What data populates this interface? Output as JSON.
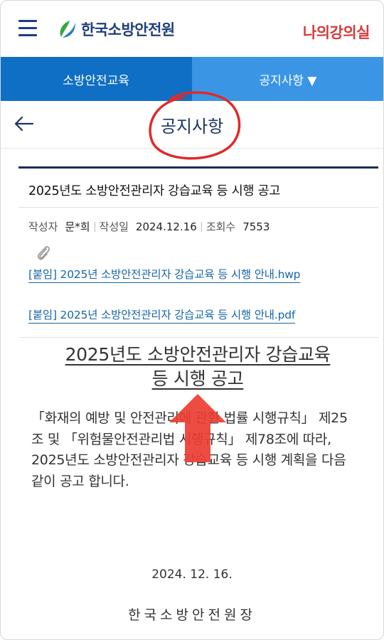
{
  "header": {
    "logo_text": "한국소방안전원",
    "my_course": "나의강의실"
  },
  "nav": {
    "tab1": "소방안전교육",
    "tab2": "공지사항 ▼"
  },
  "page": {
    "title": "공지사항"
  },
  "notice": {
    "title": "2025년도 소방안전관리자 강습교육 등 시행 공고",
    "meta": {
      "author_label": "작성자",
      "author": "문*희",
      "date_label": "작성일",
      "date": "2024.12.16",
      "views_label": "조회수",
      "views": "7553"
    },
    "attachments": [
      "[붙임] 2025년 소방안전관리자 강습교육 등 시행 안내.hwp",
      "[붙임] 2025년 소방안전관리자 강습교육 등 시행 안내.pdf"
    ]
  },
  "document": {
    "title_line1": "2025년도 소방안전관리자 강습교육",
    "title_line2": "등 시행 공고",
    "body": "「화재의 예방 및 안전관리에 관한 법률 시행규칙」 제25조 및 「위험물안전관리법 시행규칙」 제78조에 따라, 2025년도 소방안전관리자 강습교육 등 시행 계획을 다음 같이 공고 합니다.",
    "date": "2024. 12. 16.",
    "signer": "한국소방안전원장"
  },
  "colors": {
    "nav_primary": "#0f6fc4",
    "nav_secondary": "#3a96e4",
    "annotation_red": "#e8332e",
    "link": "#1766a8"
  }
}
